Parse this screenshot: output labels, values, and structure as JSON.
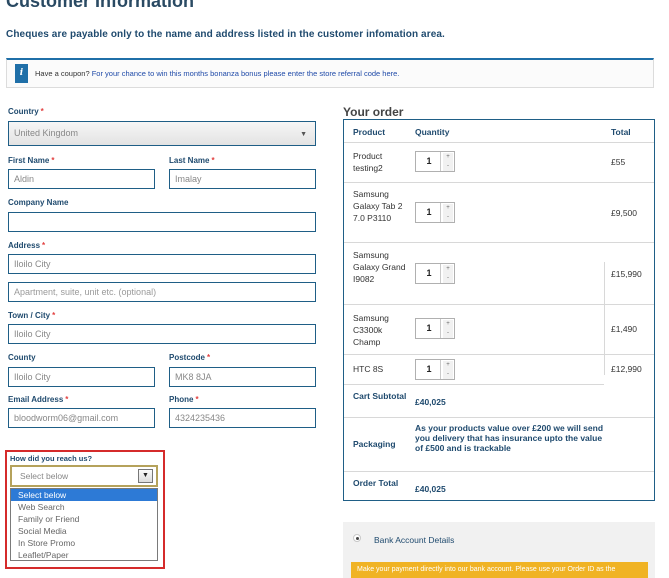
{
  "page": {
    "title": "Customer Information",
    "cheques_note": "Cheques are payable only to the name and address listed in the customer infomation area."
  },
  "coupon": {
    "prefix": "Have a coupon?",
    "link": "For your chance to win this months bonanza bonus please enter the store referral code here."
  },
  "form": {
    "required_mark": "*",
    "country": {
      "label": "Country",
      "value": "United Kingdom"
    },
    "first_name": {
      "label": "First Name",
      "value": "Aldin"
    },
    "last_name": {
      "label": "Last Name",
      "value": "Imalay"
    },
    "company_name": {
      "label": "Company Name",
      "value": ""
    },
    "address": {
      "label": "Address",
      "line1": "Iloilo City",
      "line2_placeholder": "Apartment, suite, unit etc. (optional)"
    },
    "town": {
      "label": "Town / City",
      "value": "Iloilo City"
    },
    "county": {
      "label": "County",
      "value": "Iloilo City"
    },
    "postcode": {
      "label": "Postcode",
      "value": "MK8 8JA"
    },
    "email": {
      "label": "Email Address",
      "value": "bloodworm06@gmail.com"
    },
    "phone": {
      "label": "Phone",
      "value": "4324235436"
    },
    "reach": {
      "label": "How did you reach us?",
      "selected": "Select below",
      "options": [
        "Select below",
        "Web Search",
        "Family or Friend",
        "Social Media",
        "In Store Promo",
        "Leaflet/Paper"
      ]
    }
  },
  "order": {
    "heading": "Your order",
    "columns": {
      "product": "Product",
      "quantity": "Quantity",
      "total": "Total"
    },
    "items": [
      {
        "name": "Product testing2",
        "qty": "1",
        "total": "£55"
      },
      {
        "name": "Samsung Galaxy Tab 2 7.0 P3110",
        "qty": "1",
        "total": "£9,500"
      },
      {
        "name": "Samsung Galaxy Grand I9082",
        "qty": "1",
        "total": "£15,990"
      },
      {
        "name": "Samsung C3300k Champ",
        "qty": "1",
        "total": "£1,490"
      },
      {
        "name": "HTC 8S",
        "qty": "1",
        "total": "£12,990"
      }
    ],
    "stepper": {
      "up": "+",
      "down": "-"
    },
    "cart_subtotal": {
      "label": "Cart Subtotal",
      "value": "£40,025"
    },
    "packaging": {
      "label": "Packaging",
      "text": "As your products value over £200 we will send you delivery that has insurance upto the value of £500 and is trackable"
    },
    "order_total": {
      "label": "Order Total",
      "value": "£40,025"
    }
  },
  "payment": {
    "method_label": "Bank Account Details",
    "note": "Make your payment directly into our bank account. Please use your Order ID as the"
  },
  "icons": {
    "info": "info-icon",
    "select_caret": "caret-down-icon",
    "dropdown_button": "dropdown-arrow-icon"
  },
  "colors": {
    "accent_blue": "#1f5e86",
    "label_blue": "#1f4a6e",
    "required_red": "#e24141",
    "highlight_red": "#d52b2b",
    "selected_option": "#2d7ad6",
    "payment_note": "#f0b324"
  }
}
